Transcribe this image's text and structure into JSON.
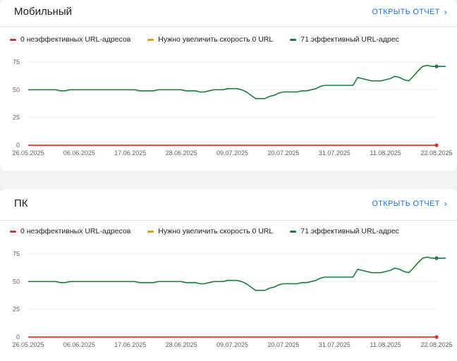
{
  "cards": [
    {
      "title": "Мобильный",
      "open_report": "ОТКРЫТЬ ОТЧЕТ",
      "legend": [
        {
          "label": "0 неэффективных URL-адресов",
          "color": "#d93025"
        },
        {
          "label": "Нужно увеличить скорость 0 URL",
          "color": "#f29900"
        },
        {
          "label": "71 эффективный URL-адрес",
          "color": "#188038"
        }
      ],
      "chart_data": {
        "type": "line",
        "x": [
          "26.05.2025",
          "27.05.2025",
          "28.05.2025",
          "29.05.2025",
          "30.05.2025",
          "31.05.2025",
          "01.06.2025",
          "02.06.2025",
          "03.06.2025",
          "04.06.2025",
          "05.06.2025",
          "06.06.2025",
          "07.06.2025",
          "08.06.2025",
          "09.06.2025",
          "10.06.2025",
          "11.06.2025",
          "12.06.2025",
          "13.06.2025",
          "14.06.2025",
          "15.06.2025",
          "16.06.2025",
          "17.06.2025",
          "18.06.2025",
          "19.06.2025",
          "20.06.2025",
          "21.06.2025",
          "22.06.2025",
          "23.06.2025",
          "24.06.2025",
          "25.06.2025",
          "26.06.2025",
          "27.06.2025",
          "28.06.2025",
          "29.06.2025",
          "30.06.2025",
          "01.07.2025",
          "02.07.2025",
          "03.07.2025",
          "04.07.2025",
          "05.07.2025",
          "06.07.2025",
          "07.07.2025",
          "08.07.2025",
          "09.07.2025",
          "10.07.2025",
          "11.07.2025",
          "12.07.2025",
          "13.07.2025",
          "14.07.2025",
          "15.07.2025",
          "16.07.2025",
          "17.07.2025",
          "18.07.2025",
          "19.07.2025",
          "20.07.2025",
          "21.07.2025",
          "22.07.2025",
          "23.07.2025",
          "24.07.2025",
          "25.07.2025",
          "26.07.2025",
          "27.07.2025",
          "28.07.2025",
          "29.07.2025",
          "30.07.2025",
          "31.07.2025",
          "01.08.2025",
          "02.08.2025",
          "03.08.2025",
          "04.08.2025",
          "05.08.2025",
          "06.08.2025",
          "07.08.2025",
          "08.08.2025",
          "09.08.2025",
          "10.08.2025",
          "11.08.2025",
          "12.08.2025",
          "13.08.2025",
          "14.08.2025",
          "15.08.2025",
          "16.08.2025",
          "17.08.2025",
          "18.08.2025",
          "19.08.2025",
          "20.08.2025",
          "21.08.2025",
          "22.08.2025"
        ],
        "x_ticks": [
          "26.05.2025",
          "06.06.2025",
          "17.06.2025",
          "28.06.2025",
          "09.07.2025",
          "20.07.2025",
          "31.07.2025",
          "11.08.2025",
          "22.08.2025"
        ],
        "y_ticks": [
          0,
          25,
          50,
          75
        ],
        "ylim": [
          0,
          80
        ],
        "series": [
          {
            "name": "0 неэффективных URL-адресов",
            "color": "#d93025",
            "values": [
              0,
              0,
              0,
              0,
              0,
              0,
              0,
              0,
              0,
              0,
              0,
              0,
              0,
              0,
              0,
              0,
              0,
              0,
              0,
              0,
              0,
              0,
              0,
              0,
              0,
              0,
              0,
              0,
              0,
              0,
              0,
              0,
              0,
              0,
              0,
              0,
              0,
              0,
              0,
              0,
              0,
              0,
              0,
              0,
              0,
              0,
              0,
              0,
              0,
              0,
              0,
              0,
              0,
              0,
              0,
              0,
              0,
              0,
              0,
              0,
              0,
              0,
              0,
              0,
              0,
              0,
              0,
              0,
              0,
              0,
              0,
              0,
              0,
              0,
              0,
              0,
              0,
              0,
              0,
              0,
              0,
              0,
              0,
              0,
              0,
              0,
              0,
              0,
              0
            ]
          },
          {
            "name": "Нужно увеличить скорость 0 URL",
            "color": "#f29900",
            "values": [
              0,
              0,
              0,
              0,
              0,
              0,
              0,
              0,
              0,
              0,
              0,
              0,
              0,
              0,
              0,
              0,
              0,
              0,
              0,
              0,
              0,
              0,
              0,
              0,
              0,
              0,
              0,
              0,
              0,
              0,
              0,
              0,
              0,
              0,
              0,
              0,
              0,
              0,
              0,
              0,
              0,
              0,
              0,
              0,
              0,
              0,
              0,
              0,
              0,
              0,
              0,
              0,
              0,
              0,
              0,
              0,
              0,
              0,
              0,
              0,
              0,
              0,
              0,
              0,
              0,
              0,
              0,
              0,
              0,
              0,
              0,
              0,
              0,
              0,
              0,
              0,
              0,
              0,
              0,
              0,
              0,
              0,
              0,
              0,
              0,
              0,
              0,
              0,
              0
            ]
          },
          {
            "name": "71 эффективный URL-адрес",
            "color": "#188038",
            "values": [
              50,
              50,
              50,
              50,
              50,
              50,
              50,
              49,
              49,
              50,
              50,
              50,
              50,
              50,
              50,
              50,
              50,
              50,
              50,
              50,
              50,
              50,
              50,
              50,
              49,
              49,
              49,
              49,
              50,
              50,
              50,
              50,
              50,
              50,
              49,
              49,
              49,
              48,
              48,
              49,
              50,
              50,
              50,
              51,
              51,
              51,
              50,
              48,
              45,
              42,
              42,
              42,
              44,
              45,
              47,
              48,
              48,
              48,
              48,
              49,
              49,
              50,
              51,
              53,
              54,
              54,
              54,
              54,
              54,
              54,
              54,
              61,
              60,
              59,
              58,
              58,
              58,
              59,
              60,
              62,
              61,
              59,
              58,
              62,
              67,
              71,
              72,
              71,
              71,
              71,
              71
            ]
          }
        ]
      }
    },
    {
      "title": "ПК",
      "open_report": "ОТКРЫТЬ ОТЧЕТ",
      "legend": [
        {
          "label": "0 неэффективных URL-адресов",
          "color": "#d93025"
        },
        {
          "label": "Нужно увеличить скорость 0 URL",
          "color": "#f29900"
        },
        {
          "label": "71 эффективный URL-адрес",
          "color": "#188038"
        }
      ],
      "chart_data": {
        "type": "line",
        "x": [
          "26.05.2025",
          "27.05.2025",
          "28.05.2025",
          "29.05.2025",
          "30.05.2025",
          "31.05.2025",
          "01.06.2025",
          "02.06.2025",
          "03.06.2025",
          "04.06.2025",
          "05.06.2025",
          "06.06.2025",
          "07.06.2025",
          "08.06.2025",
          "09.06.2025",
          "10.06.2025",
          "11.06.2025",
          "12.06.2025",
          "13.06.2025",
          "14.06.2025",
          "15.06.2025",
          "16.06.2025",
          "17.06.2025",
          "18.06.2025",
          "19.06.2025",
          "20.06.2025",
          "21.06.2025",
          "22.06.2025",
          "23.06.2025",
          "24.06.2025",
          "25.06.2025",
          "26.06.2025",
          "27.06.2025",
          "28.06.2025",
          "29.06.2025",
          "30.06.2025",
          "01.07.2025",
          "02.07.2025",
          "03.07.2025",
          "04.07.2025",
          "05.07.2025",
          "06.07.2025",
          "07.07.2025",
          "08.07.2025",
          "09.07.2025",
          "10.07.2025",
          "11.07.2025",
          "12.07.2025",
          "13.07.2025",
          "14.07.2025",
          "15.07.2025",
          "16.07.2025",
          "17.07.2025",
          "18.07.2025",
          "19.07.2025",
          "20.07.2025",
          "21.07.2025",
          "22.07.2025",
          "23.07.2025",
          "24.07.2025",
          "25.07.2025",
          "26.07.2025",
          "27.07.2025",
          "28.07.2025",
          "29.07.2025",
          "30.07.2025",
          "31.07.2025",
          "01.08.2025",
          "02.08.2025",
          "03.08.2025",
          "04.08.2025",
          "05.08.2025",
          "06.08.2025",
          "07.08.2025",
          "08.08.2025",
          "09.08.2025",
          "10.08.2025",
          "11.08.2025",
          "12.08.2025",
          "13.08.2025",
          "14.08.2025",
          "15.08.2025",
          "16.08.2025",
          "17.08.2025",
          "18.08.2025",
          "19.08.2025",
          "20.08.2025",
          "21.08.2025",
          "22.08.2025"
        ],
        "x_ticks": [
          "26.05.2025",
          "06.06.2025",
          "17.06.2025",
          "28.06.2025",
          "09.07.2025",
          "20.07.2025",
          "31.07.2025",
          "11.08.2025",
          "22.08.2025"
        ],
        "y_ticks": [
          0,
          25,
          50,
          75
        ],
        "ylim": [
          0,
          80
        ],
        "series": [
          {
            "name": "0 неэффективных URL-адресов",
            "color": "#d93025",
            "values": [
              0,
              0,
              0,
              0,
              0,
              0,
              0,
              0,
              0,
              0,
              0,
              0,
              0,
              0,
              0,
              0,
              0,
              0,
              0,
              0,
              0,
              0,
              0,
              0,
              0,
              0,
              0,
              0,
              0,
              0,
              0,
              0,
              0,
              0,
              0,
              0,
              0,
              0,
              0,
              0,
              0,
              0,
              0,
              0,
              0,
              0,
              0,
              0,
              0,
              0,
              0,
              0,
              0,
              0,
              0,
              0,
              0,
              0,
              0,
              0,
              0,
              0,
              0,
              0,
              0,
              0,
              0,
              0,
              0,
              0,
              0,
              0,
              0,
              0,
              0,
              0,
              0,
              0,
              0,
              0,
              0,
              0,
              0,
              0,
              0,
              0,
              0,
              0,
              0
            ]
          },
          {
            "name": "Нужно увеличить скорость 0 URL",
            "color": "#f29900",
            "values": [
              0,
              0,
              0,
              0,
              0,
              0,
              0,
              0,
              0,
              0,
              0,
              0,
              0,
              0,
              0,
              0,
              0,
              0,
              0,
              0,
              0,
              0,
              0,
              0,
              0,
              0,
              0,
              0,
              0,
              0,
              0,
              0,
              0,
              0,
              0,
              0,
              0,
              0,
              0,
              0,
              0,
              0,
              0,
              0,
              0,
              0,
              0,
              0,
              0,
              0,
              0,
              0,
              0,
              0,
              0,
              0,
              0,
              0,
              0,
              0,
              0,
              0,
              0,
              0,
              0,
              0,
              0,
              0,
              0,
              0,
              0,
              0,
              0,
              0,
              0,
              0,
              0,
              0,
              0,
              0,
              0,
              0,
              0,
              0,
              0,
              0,
              0,
              0,
              0
            ]
          },
          {
            "name": "71 эффективный URL-адрес",
            "color": "#188038",
            "values": [
              50,
              50,
              50,
              50,
              50,
              50,
              50,
              49,
              49,
              50,
              50,
              50,
              50,
              50,
              50,
              50,
              50,
              50,
              50,
              50,
              50,
              50,
              50,
              50,
              49,
              49,
              49,
              49,
              50,
              50,
              50,
              50,
              50,
              50,
              49,
              49,
              49,
              48,
              48,
              49,
              50,
              50,
              50,
              51,
              51,
              51,
              50,
              48,
              45,
              42,
              42,
              42,
              44,
              45,
              47,
              48,
              48,
              48,
              48,
              49,
              49,
              50,
              51,
              53,
              54,
              54,
              54,
              54,
              54,
              54,
              54,
              61,
              60,
              59,
              58,
              58,
              58,
              59,
              60,
              62,
              61,
              59,
              58,
              62,
              67,
              71,
              72,
              71,
              71,
              71,
              71
            ]
          }
        ]
      }
    }
  ]
}
